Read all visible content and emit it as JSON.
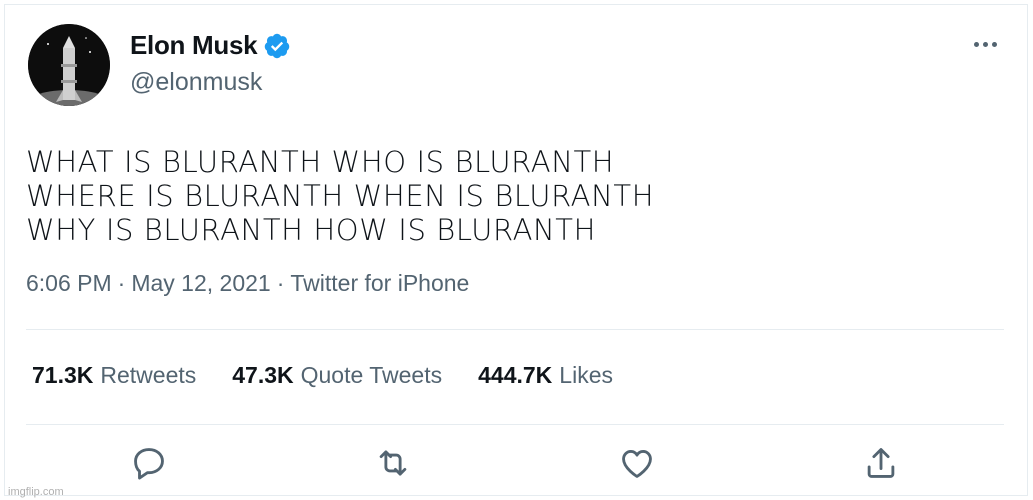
{
  "author": {
    "name": "Elon Musk",
    "handle": "@elonmusk",
    "avatar_icon": "avatar-rocket-icon",
    "verified_color": "#1d9bf0"
  },
  "tweet": {
    "lines": [
      "WHAT IS BLURANTH WHO IS BLURANTH",
      "WHERE IS BLURANTH WHEN IS BLURANTH",
      "WHY IS BLURANTH HOW IS BLURANTH"
    ],
    "meta": {
      "time": "6:06 PM",
      "date": "May 12, 2021",
      "source": "Twitter for iPhone",
      "separator": "·"
    }
  },
  "stats": [
    {
      "count": "71.3K",
      "label": "Retweets"
    },
    {
      "count": "47.3K",
      "label": "Quote Tweets"
    },
    {
      "count": "444.7K",
      "label": "Likes"
    }
  ],
  "actions": [
    "reply-icon",
    "retweet-icon",
    "like-icon",
    "share-icon"
  ],
  "watermark": "imgflip.com",
  "colors": {
    "text": "#0f1419",
    "secondary": "#536471",
    "border": "#e6ecf0"
  }
}
